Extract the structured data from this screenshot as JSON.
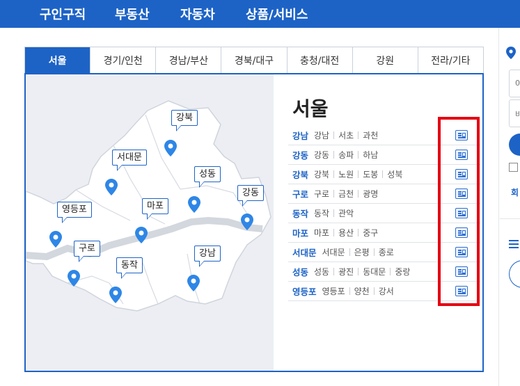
{
  "topnav": [
    "구인구직",
    "부동산",
    "자동차",
    "상품/서비스"
  ],
  "tabs": [
    "서울",
    "경기/인천",
    "경남/부산",
    "경북/대구",
    "충청/대전",
    "강원",
    "전라/기타"
  ],
  "active_tab": "서울",
  "region_title": "서울",
  "map_labels": [
    "강북",
    "서대문",
    "성동",
    "강동",
    "영등포",
    "마포",
    "구로",
    "동작",
    "강남"
  ],
  "districts": [
    {
      "name": "강남",
      "subs": [
        "강남",
        "서초",
        "과천"
      ]
    },
    {
      "name": "강동",
      "subs": [
        "강동",
        "송파",
        "하남"
      ]
    },
    {
      "name": "강북",
      "subs": [
        "강북",
        "노원",
        "도봉",
        "성북"
      ]
    },
    {
      "name": "구로",
      "subs": [
        "구로",
        "금천",
        "광명"
      ]
    },
    {
      "name": "동작",
      "subs": [
        "동작",
        "관악"
      ]
    },
    {
      "name": "마포",
      "subs": [
        "마포",
        "용산",
        "중구"
      ]
    },
    {
      "name": "서대문",
      "subs": [
        "서대문",
        "은평",
        "종로"
      ]
    },
    {
      "name": "성동",
      "subs": [
        "성동",
        "광진",
        "동대문",
        "중랑"
      ]
    },
    {
      "name": "영등포",
      "subs": [
        "영등포",
        "양천",
        "강서"
      ]
    }
  ],
  "sidebar": {
    "field1_text": "0",
    "field2_text": "비",
    "link_text": "회"
  },
  "colors": {
    "brand_blue": "#1d63c6",
    "highlight_red": "#e60012",
    "map_bg": "#eceef3"
  },
  "icons": {
    "row_icon": "newspaper-icon",
    "pin": "map-pin-icon",
    "menu": "hamburger-icon"
  }
}
